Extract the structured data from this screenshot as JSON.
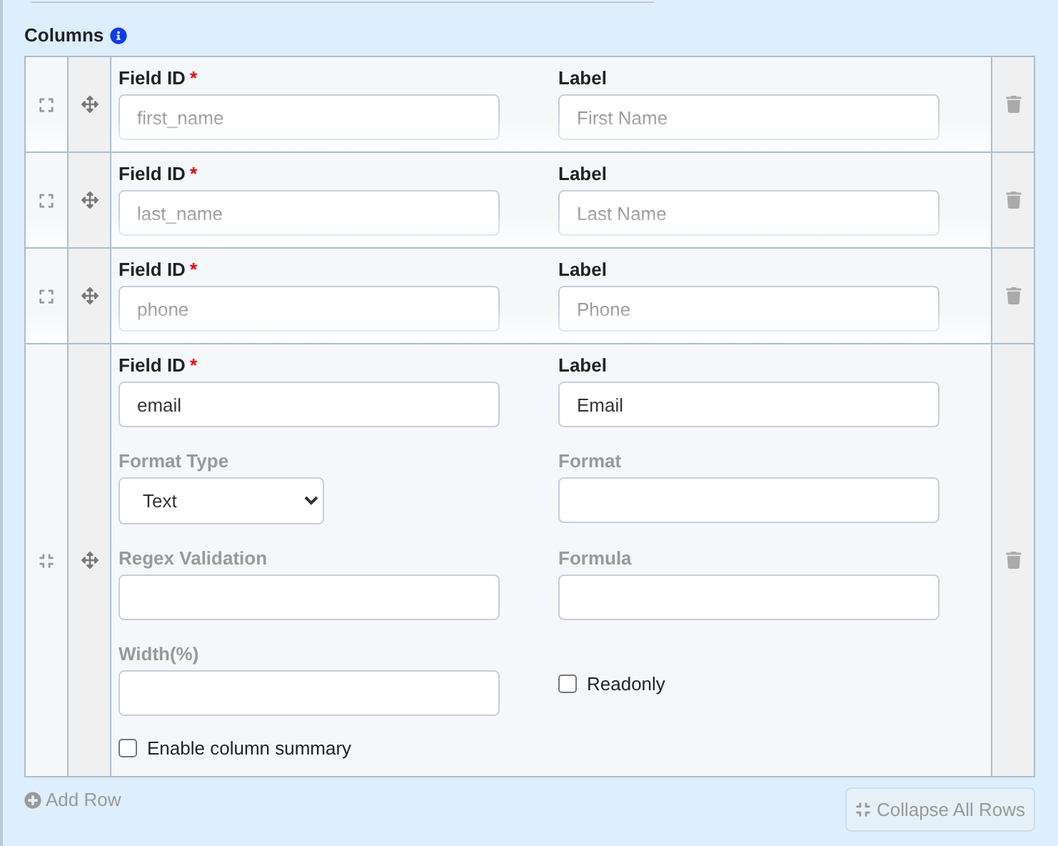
{
  "section": {
    "title": "Columns"
  },
  "rows": [
    {
      "expanded": false,
      "fields": [
        {
          "kind": "text",
          "label": "Field ID",
          "required_mark": "*",
          "disabled": false,
          "value": "first_name"
        },
        {
          "kind": "text",
          "label": "Label",
          "disabled": false,
          "value": "First Name"
        }
      ]
    },
    {
      "expanded": false,
      "fields": [
        {
          "kind": "text",
          "label": "Field ID",
          "required_mark": "*",
          "disabled": false,
          "value": "last_name"
        },
        {
          "kind": "text",
          "label": "Label",
          "disabled": false,
          "value": "Last Name"
        }
      ]
    },
    {
      "expanded": false,
      "fields": [
        {
          "kind": "text",
          "label": "Field ID",
          "required_mark": "*",
          "disabled": false,
          "value": "phone"
        },
        {
          "kind": "text",
          "label": "Label",
          "disabled": false,
          "value": "Phone"
        }
      ]
    },
    {
      "expanded": true,
      "fields": [
        {
          "kind": "text",
          "label": "Field ID",
          "required_mark": "*",
          "disabled": false,
          "value": "email"
        },
        {
          "kind": "text",
          "label": "Label",
          "disabled": false,
          "value": "Email"
        },
        {
          "kind": "select",
          "label": "Format Type",
          "disabled": true,
          "value": "Text"
        },
        {
          "kind": "text",
          "label": "Format",
          "disabled": true
        },
        {
          "kind": "text",
          "label": "Regex Validation",
          "disabled": true
        },
        {
          "kind": "text",
          "label": "Formula",
          "disabled": true
        },
        {
          "kind": "text",
          "label": "Width(%)",
          "disabled": true
        },
        {
          "kind": "checkbox",
          "label": "Readonly",
          "checked": false
        },
        {
          "kind": "checkbox",
          "label": "Enable column summary",
          "checked": false
        }
      ]
    }
  ],
  "add_row": "Add Row",
  "collapse_button": {
    "label": "Collapse All Rows",
    "disabled": true
  }
}
